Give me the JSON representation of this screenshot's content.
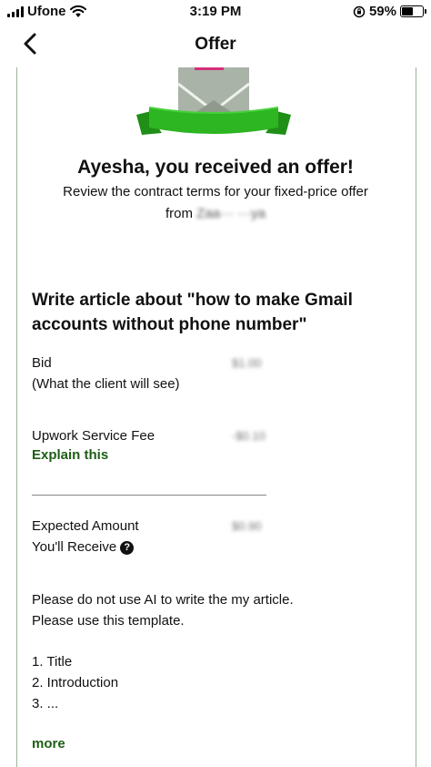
{
  "status_bar": {
    "carrier": "Ufone",
    "time": "3:19 PM",
    "battery": "59%",
    "battery_level": 0.59
  },
  "nav": {
    "title": "Offer"
  },
  "offer": {
    "headline": "Ayesha, you received an offer!",
    "subtitle_line1": "Review the contract terms for your fixed-price offer",
    "subtitle_from": "from",
    "client_name": "Zaa··· ···ya"
  },
  "job": {
    "title": "Write article about \"how to make Gmail accounts without phone number\""
  },
  "terms": {
    "bid_label": "Bid",
    "bid_sublabel": "(What the client will see)",
    "bid_value": "$1.00",
    "fee_label": "Upwork Service Fee",
    "fee_link": "Explain this",
    "fee_value": "-$0.10",
    "expected_label": "Expected Amount",
    "expected_sublabel": "You'll Receive",
    "expected_value": "$0.90"
  },
  "description": {
    "line1": "Please do not use AI to write the my article.",
    "line2": "Please use this template.",
    "item1": "1. Title",
    "item2": "2. Introduction",
    "item3": "3. ...",
    "more_link": "more"
  },
  "colors": {
    "accent_green": "#1e5e16",
    "ribbon_green": "#2db522",
    "frame_line": "#9db39b"
  }
}
